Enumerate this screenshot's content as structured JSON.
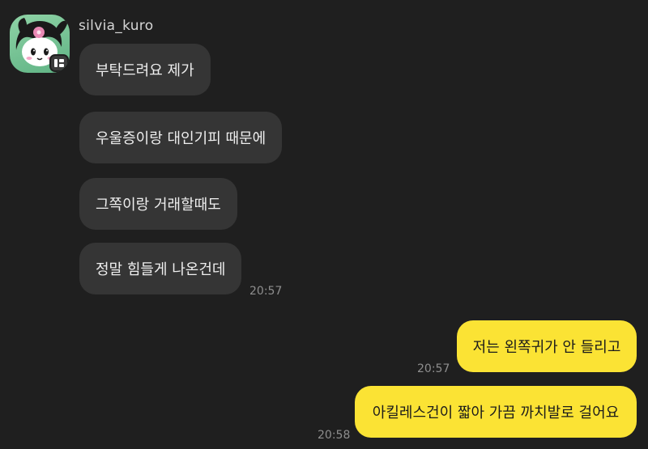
{
  "conversation": {
    "sender": {
      "name": "silvia_kuro",
      "avatar_icon": "kuromi-character-avatar"
    },
    "incoming": [
      {
        "text": "부탁드려요 제가"
      },
      {
        "text": "우울증이랑 대인기피 때문에"
      },
      {
        "text": "그쪽이랑 거래할때도"
      },
      {
        "text": "정말 힘들게 나온건데"
      }
    ],
    "incoming_time": "20:57",
    "outgoing": [
      {
        "text": "저는 왼쪽귀가 안 들리고",
        "time": "20:57"
      },
      {
        "text": "아킬레스건이 짧아 가끔 까치발로 걸어요",
        "time": "20:58"
      }
    ]
  },
  "colors": {
    "background": "#1f1f1f",
    "incoming_bubble": "#353535",
    "outgoing_bubble": "#fbe334",
    "timestamp": "#8e8e8e"
  }
}
